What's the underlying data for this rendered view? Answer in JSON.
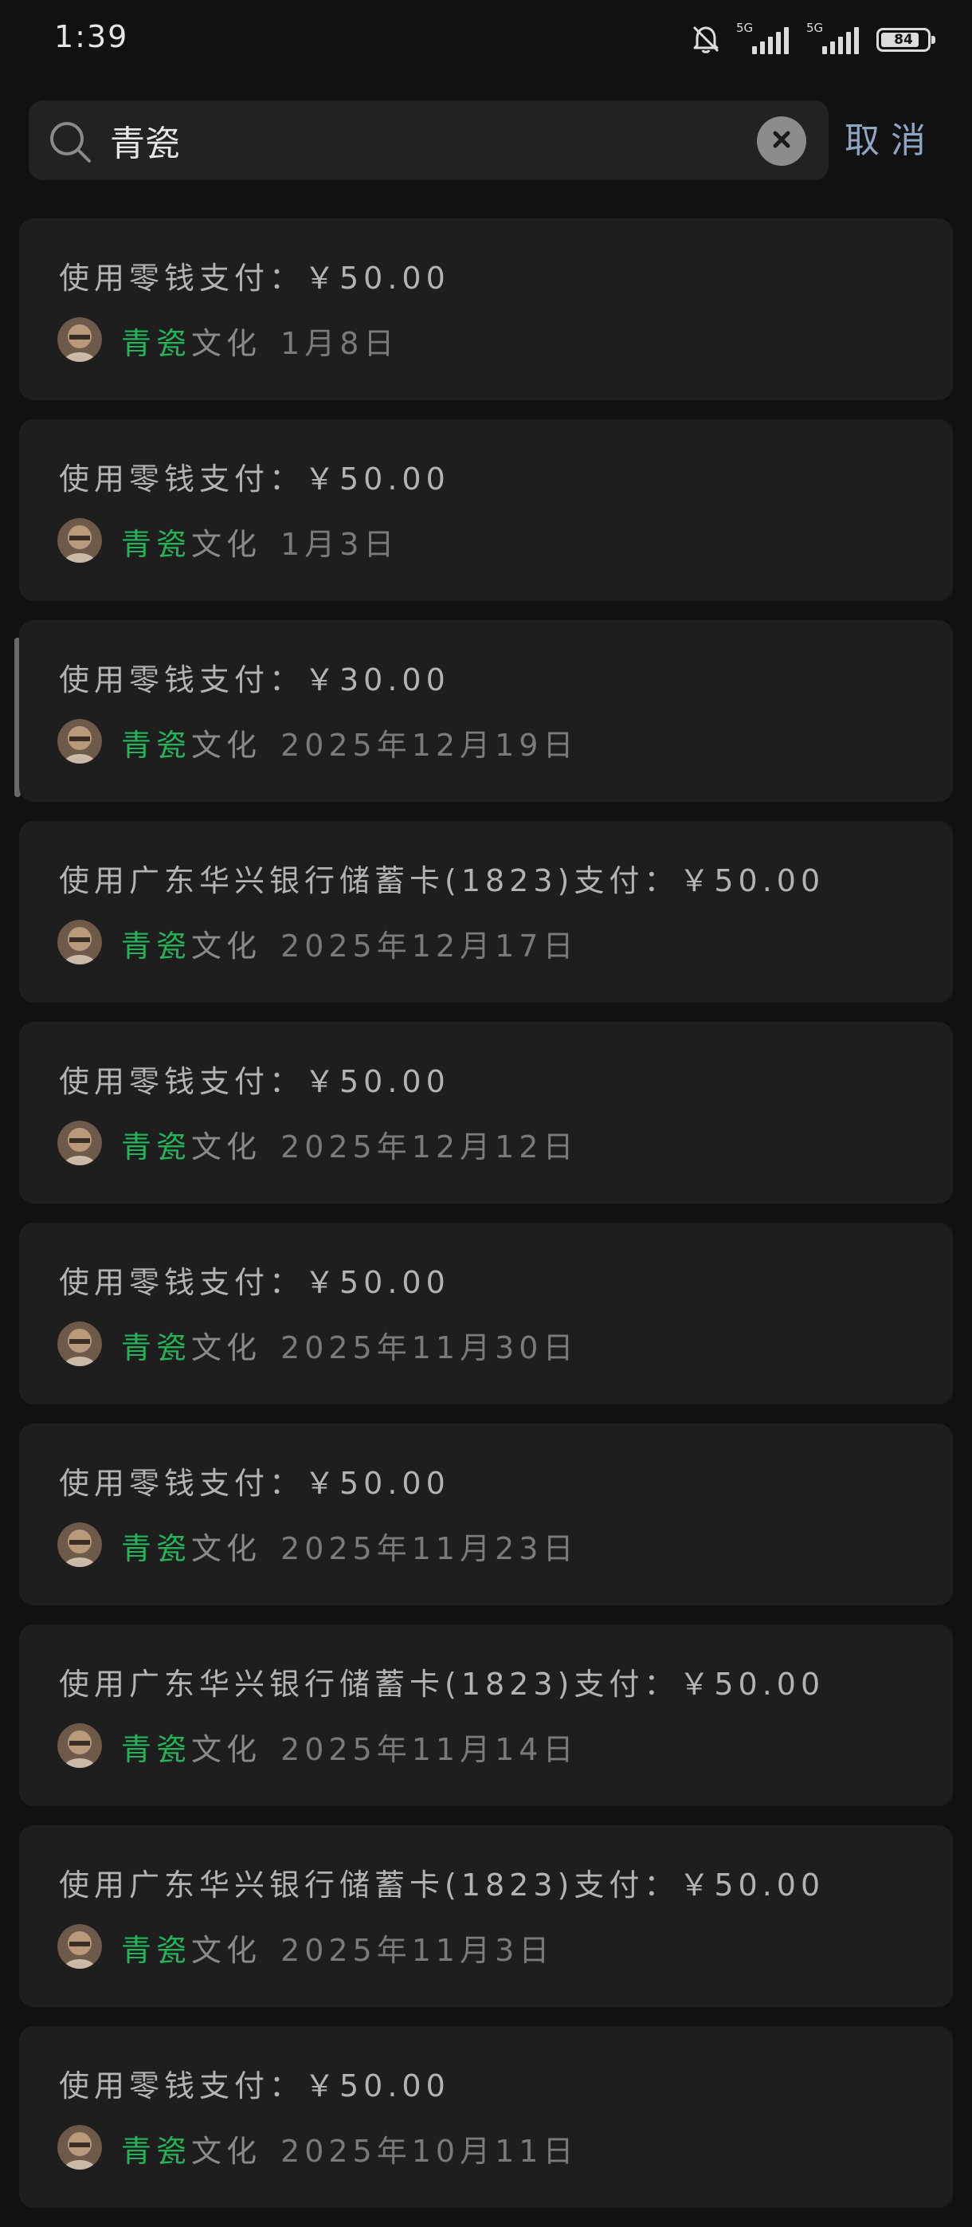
{
  "status_bar": {
    "time": "1:39",
    "network_1": "5G",
    "network_2": "5G",
    "battery": "84",
    "battery_level": 0.84
  },
  "search": {
    "query": "青瓷",
    "placeholder": "",
    "cancel_label": "取消"
  },
  "colors": {
    "keyword": "#26b25a",
    "cancel": "#8ea6c4",
    "card": "#1e1e1e",
    "background": "#111111"
  },
  "records": [
    {
      "title": "使用零钱支付：￥50.00",
      "keyword": "青瓷",
      "rest": "文化",
      "date": "1月8日"
    },
    {
      "title": "使用零钱支付：￥50.00",
      "keyword": "青瓷",
      "rest": "文化",
      "date": "1月3日"
    },
    {
      "title": "使用零钱支付：￥30.00",
      "keyword": "青瓷",
      "rest": "文化",
      "date": "2025年12月19日"
    },
    {
      "title": "使用广东华兴银行储蓄卡(1823)支付：￥50.00",
      "keyword": "青瓷",
      "rest": "文化",
      "date": "2025年12月17日"
    },
    {
      "title": "使用零钱支付：￥50.00",
      "keyword": "青瓷",
      "rest": "文化",
      "date": "2025年12月12日"
    },
    {
      "title": "使用零钱支付：￥50.00",
      "keyword": "青瓷",
      "rest": "文化",
      "date": "2025年11月30日"
    },
    {
      "title": "使用零钱支付：￥50.00",
      "keyword": "青瓷",
      "rest": "文化",
      "date": "2025年11月23日"
    },
    {
      "title": "使用广东华兴银行储蓄卡(1823)支付：￥50.00",
      "keyword": "青瓷",
      "rest": "文化",
      "date": "2025年11月14日"
    },
    {
      "title": "使用广东华兴银行储蓄卡(1823)支付：￥50.00",
      "keyword": "青瓷",
      "rest": "文化",
      "date": "2025年11月3日"
    },
    {
      "title": "使用零钱支付：￥50.00",
      "keyword": "青瓷",
      "rest": "文化",
      "date": "2025年10月11日"
    }
  ]
}
